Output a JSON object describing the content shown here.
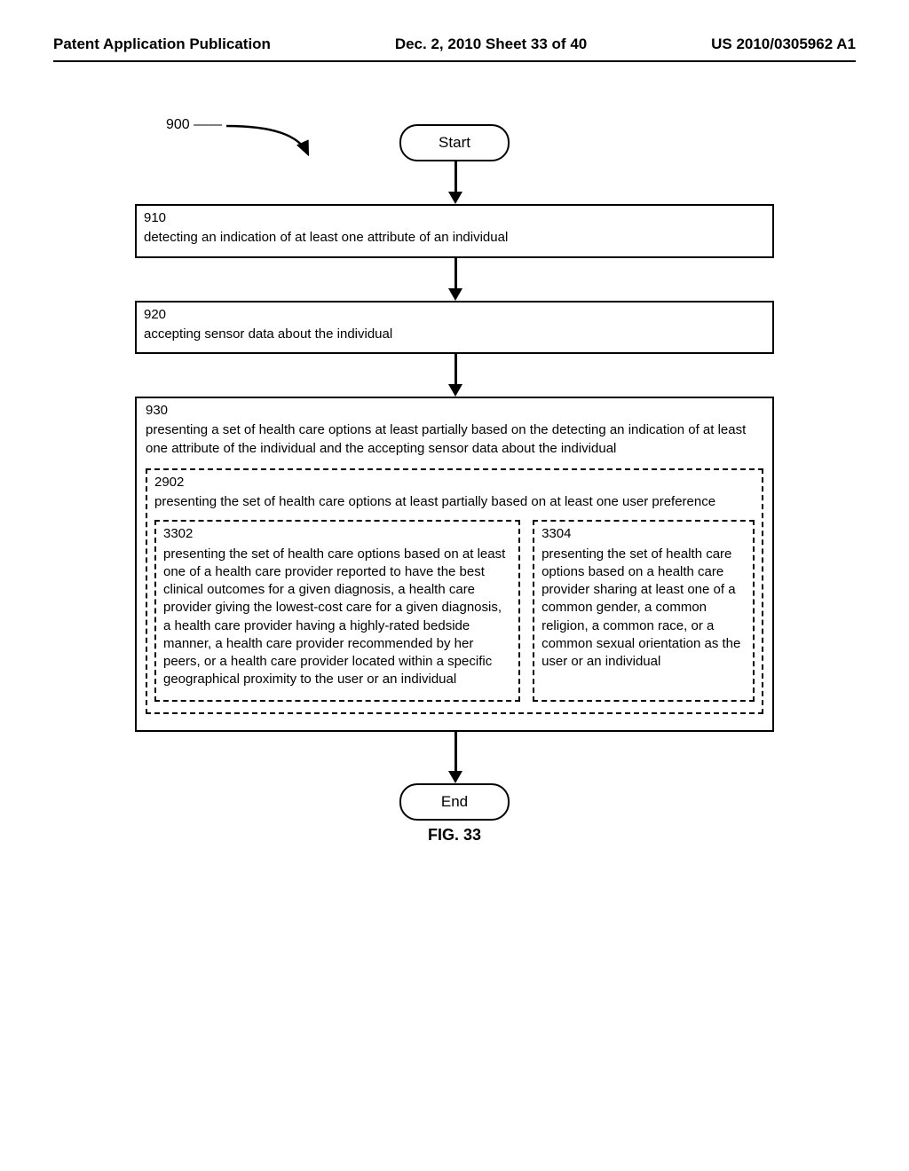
{
  "header": {
    "left": "Patent Application Publication",
    "center": "Dec. 2, 2010   Sheet 33 of 40",
    "right": "US 2010/0305962 A1"
  },
  "diagram": {
    "ref": "900",
    "start": "Start",
    "end": "End",
    "figure_label": "FIG. 33",
    "box910": {
      "num": "910",
      "text": "detecting an indication of at least one attribute of an individual"
    },
    "box920": {
      "num": "920",
      "text": "accepting sensor data about the individual"
    },
    "box930": {
      "num": "930",
      "text": "presenting a set of health care options at least partially based on the detecting an indication of at least one attribute of the individual and the accepting sensor data about the individual"
    },
    "box2902": {
      "num": "2902",
      "text": "presenting the set of health care options at least partially based on at least one user preference"
    },
    "box3302": {
      "num": "3302",
      "text": "presenting the set of health care options based on at least one of a health care provider reported to have the best clinical outcomes for a given diagnosis, a health care provider giving the lowest-cost care for a given diagnosis, a health care provider having a highly-rated bedside manner, a health care provider recommended by her peers, or a health care provider located within a specific geographical proximity to the user or an individual"
    },
    "box3304": {
      "num": "3304",
      "text": "presenting the set of health care options based on a health care provider sharing at least one of a common gender, a common religion, a common race, or a common sexual orientation as the user or an individual"
    }
  }
}
